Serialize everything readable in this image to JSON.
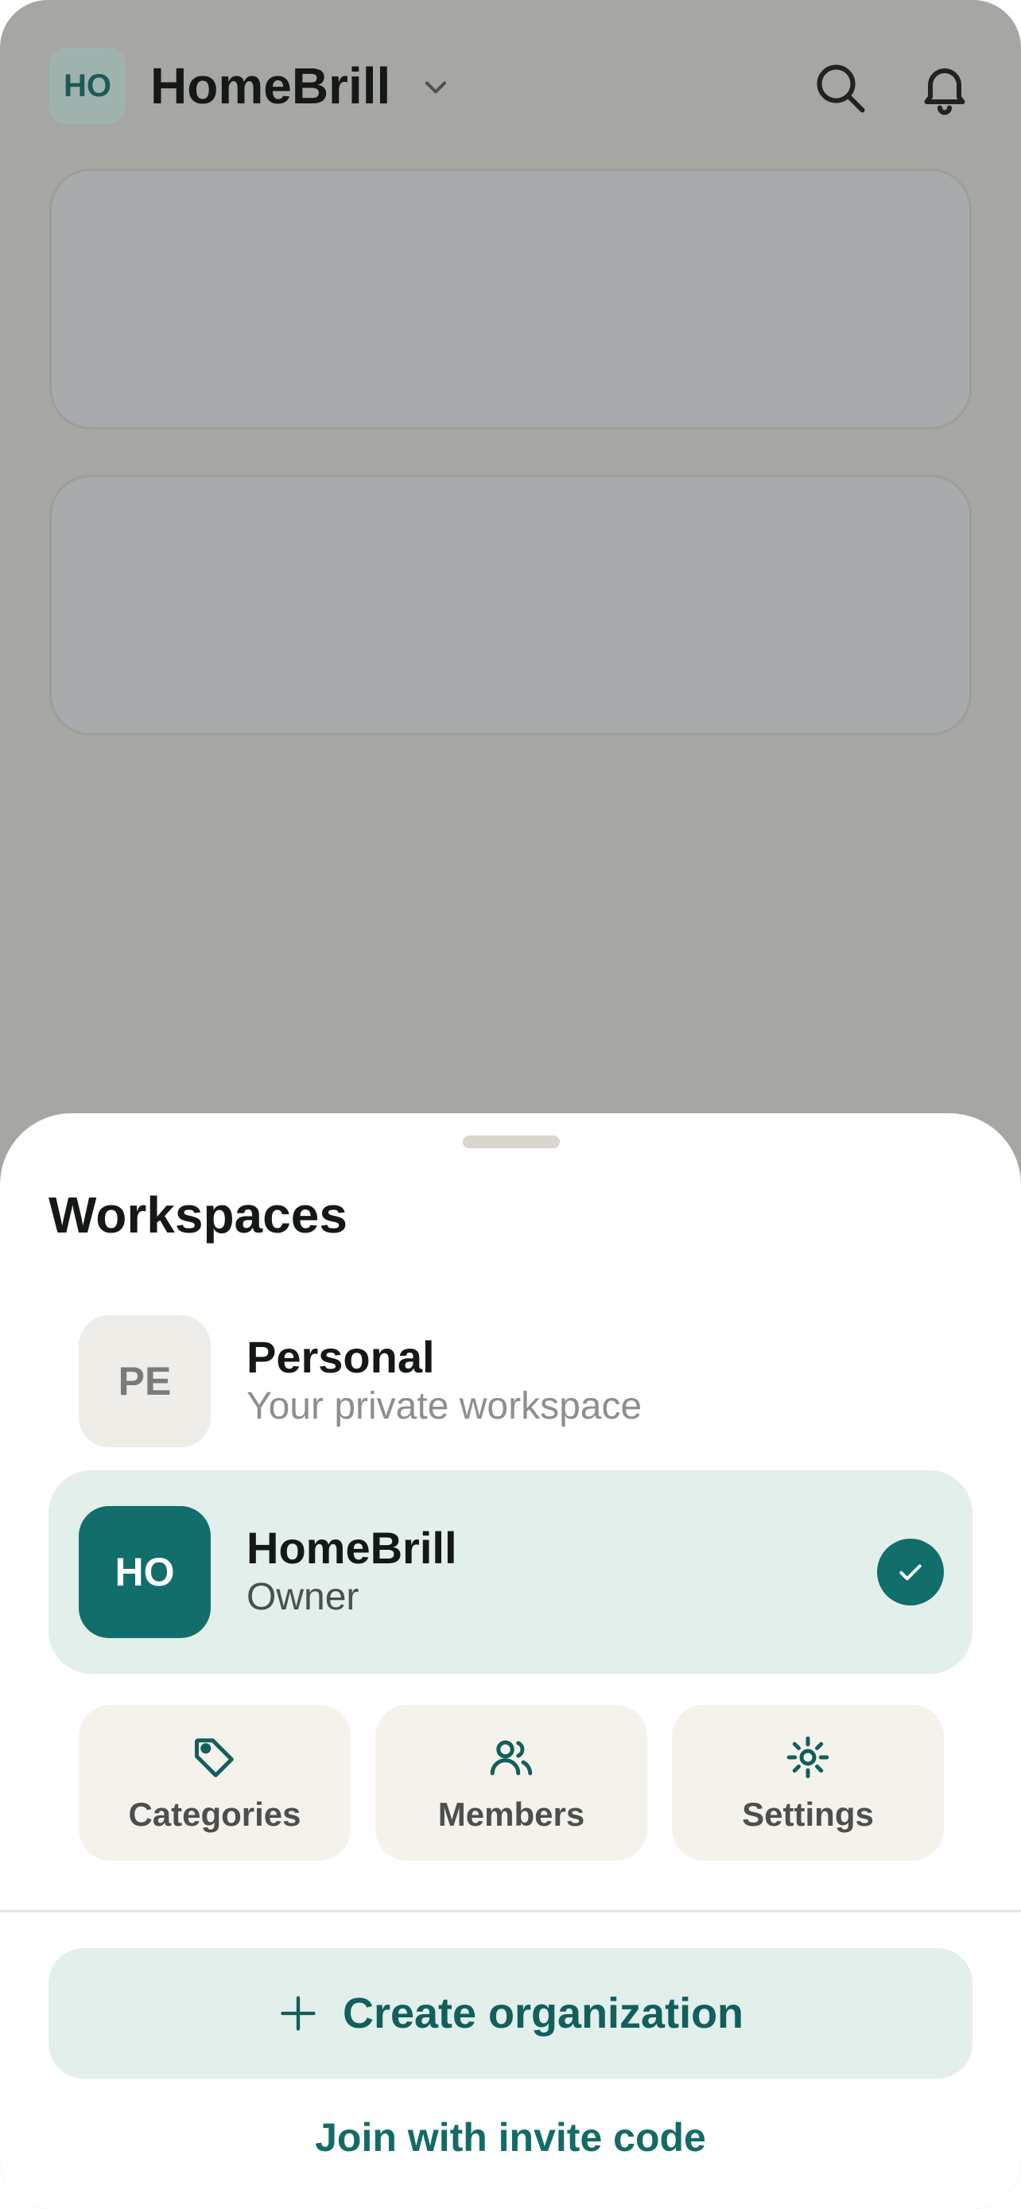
{
  "header": {
    "org_initials": "HO",
    "org_name": "HomeBrill",
    "chevron_icon": "chevron-down-icon",
    "search_icon": "search-icon",
    "bell_icon": "bell-icon"
  },
  "sheet": {
    "title": "Workspaces",
    "workspaces": [
      {
        "initials": "PE",
        "name": "Personal",
        "subtitle": "Your private workspace",
        "selected": false
      },
      {
        "initials": "HO",
        "name": "HomeBrill",
        "subtitle": "Owner",
        "selected": true
      }
    ],
    "actions": [
      {
        "label": "Categories",
        "icon": "tag-icon"
      },
      {
        "label": "Members",
        "icon": "users-icon"
      },
      {
        "label": "Settings",
        "icon": "gear-icon"
      }
    ],
    "create_label": "Create organization",
    "join_label": "Join with invite code"
  },
  "colors": {
    "accent": "#116e6a",
    "accent_light": "#e2efeb",
    "scrim": "#a6a7a2"
  }
}
